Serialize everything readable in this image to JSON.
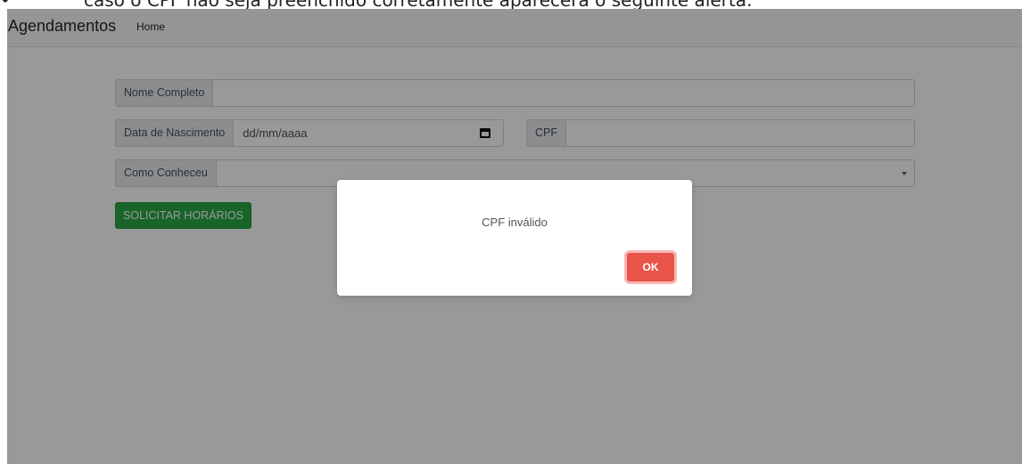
{
  "document": {
    "bullet": "•",
    "caption": "caso o CPF não seja preenchido corretamente aparecerá o seguinte alerta:"
  },
  "navbar": {
    "brand": "Agendamentos",
    "links": [
      "Home"
    ]
  },
  "form": {
    "full_name": {
      "label": "Nome Completo",
      "value": ""
    },
    "birth_date": {
      "label": "Data de Nascimento",
      "value": "dd/mm/aaaa",
      "icon": "calendar-icon"
    },
    "cpf": {
      "label": "CPF",
      "value": ""
    },
    "referral": {
      "label": "Como Conheceu",
      "value": "",
      "icon": "chevron-down-icon"
    },
    "submit_label": "SOLICITAR HORÁRIOS"
  },
  "alert": {
    "message": "CPF inválido",
    "confirm_label": "OK"
  },
  "colors": {
    "submit_button": "#28a745",
    "confirm_button": "#e8534a",
    "overlay": "rgba(0,0,0,0.4)"
  }
}
